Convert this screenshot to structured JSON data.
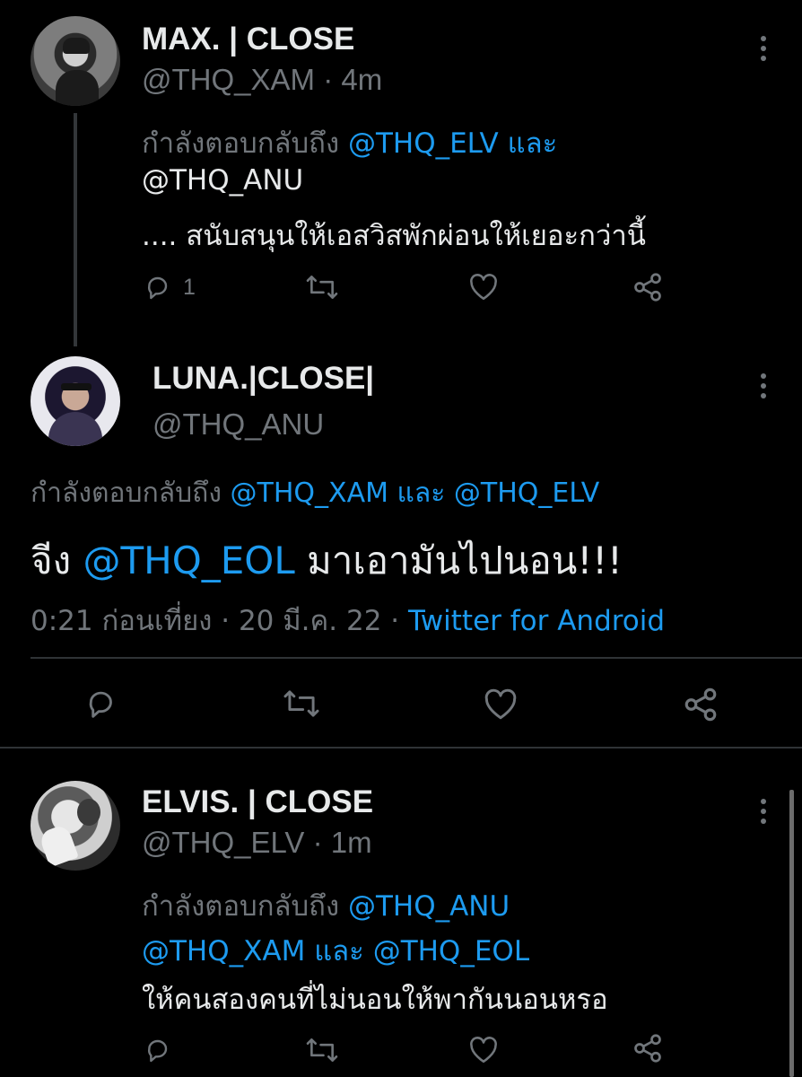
{
  "tweets": [
    {
      "name": "MAX. | CLOSE",
      "handle": "@THQ_XAM",
      "time": " · 4m",
      "reply_prefix": "กำลังตอบกลับถึง ",
      "reply_to_1": "@THQ_ELV",
      "reply_and": " และ",
      "reply_to_2": "@THQ_ANU",
      "text": ".... สนับสนุนให้เอสวิสพักผ่อนให้เยอะกว่านี้",
      "reply_count": "1"
    },
    {
      "name": "LUNA.|CLOSE|",
      "handle": "@THQ_ANU",
      "reply_prefix": "กำลังตอบกลับถึง ",
      "reply_to_1": "@THQ_XAM",
      "reply_and": " และ ",
      "reply_to_2": "@THQ_ELV",
      "text_prefix": "จีง ",
      "text_mention": "@THQ_EOL",
      "text_suffix": "  มาเอามันไปนอน!!!",
      "meta_time": "0:21 ก่อนเที่ยง · 20 มี.ค. 22 · ",
      "meta_source": "Twitter for Android"
    },
    {
      "name": "ELVIS. | CLOSE",
      "handle": "@THQ_ELV",
      "time": " · 1m",
      "reply_prefix": "กำลังตอบกลับถึง ",
      "reply_to_1": "@THQ_ANU",
      "reply_to_2": "@THQ_XAM",
      "reply_and": " และ ",
      "reply_to_3": "@THQ_EOL",
      "text": "ให้คนสองคนที่ไม่นอนให้พากันนอนหรอ"
    }
  ],
  "icons": {
    "reply": "reply-icon",
    "retweet": "retweet-icon",
    "like": "like-icon",
    "share": "share-icon",
    "more": "more-icon"
  },
  "colors": {
    "background": "#000000",
    "link": "#1d9bf0",
    "muted": "#71767b",
    "text": "#e7e9ea",
    "divider": "#2f3336"
  }
}
